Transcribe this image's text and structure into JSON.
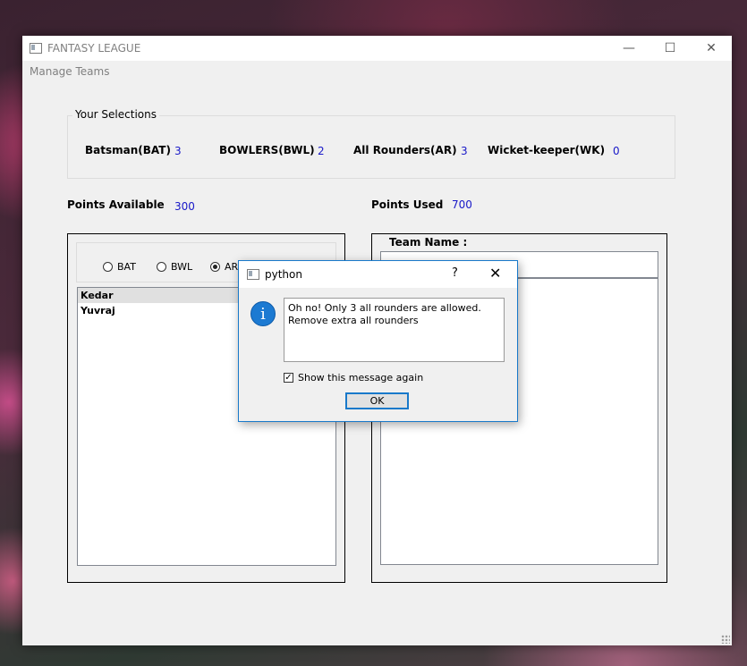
{
  "window": {
    "title": "FANTASY LEAGUE",
    "controls": {
      "minimize": "—",
      "maximize": "☐",
      "close": "✕"
    }
  },
  "menu": {
    "items": [
      {
        "label": "Manage Teams"
      }
    ]
  },
  "selections": {
    "group_title": "Your Selections",
    "batsman_label": "Batsman(BAT)",
    "batsman_count": "3",
    "bowlers_label": "BOWLERS(BWL)",
    "bowlers_count": "2",
    "allrounders_label": "All Rounders(AR)",
    "allrounders_count": "3",
    "keeper_label": "Wicket-keeper(WK)",
    "keeper_count": "0"
  },
  "points": {
    "available_label": "Points Available",
    "available_value": "300",
    "used_label": "Points Used",
    "used_value": "700"
  },
  "filters": {
    "options": [
      {
        "label": "BAT",
        "checked": false
      },
      {
        "label": "BWL",
        "checked": false
      },
      {
        "label": "AR",
        "checked": true
      }
    ]
  },
  "players": [
    {
      "name": "Kedar",
      "selected": true
    },
    {
      "name": "Yuvraj",
      "selected": false
    }
  ],
  "team": {
    "name_label": "Team Name :",
    "name_value": ""
  },
  "dialog": {
    "title": "python",
    "help": "?",
    "close": "✕",
    "icon_glyph": "i",
    "message": "Oh no! Only 3 all rounders are allowed. Remove extra all rounders",
    "checkbox_label": "Show this message again",
    "checkbox_checked": true,
    "ok_label": "OK"
  },
  "colors": {
    "value_blue": "#1818c8",
    "dialog_border": "#1979ca",
    "info_icon": "#1c7ad2"
  }
}
